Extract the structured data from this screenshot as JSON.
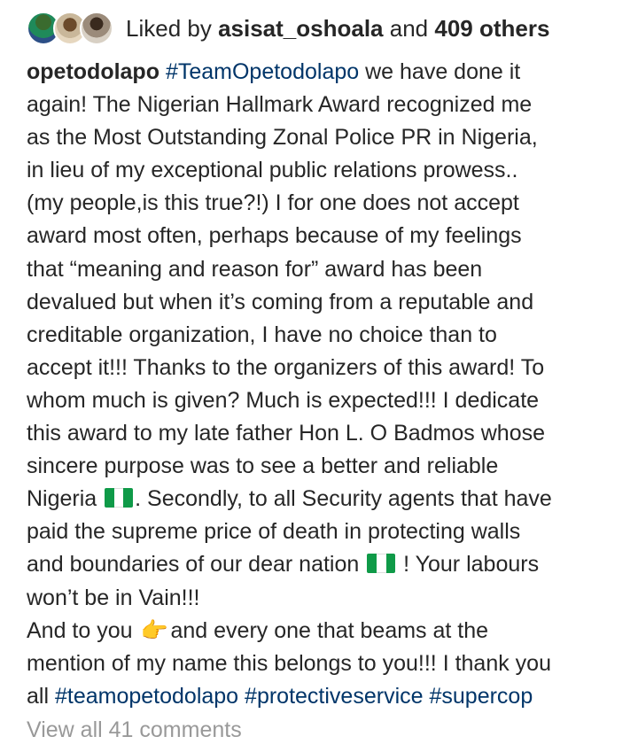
{
  "likes": {
    "prefix": "Liked by",
    "user": "asisat_oshoala",
    "conjunction": "and",
    "others": "409 others"
  },
  "post": {
    "username": "opetodolapo",
    "lines": [
      {
        "hashtag": "#TeamOpetodolapo",
        "text": " we have done it"
      },
      {
        "text": "again! The Nigerian Hallmark Award recognized me"
      },
      {
        "text": "as the Most Outstanding Zonal Police PR in Nigeria,"
      },
      {
        "text": "in lieu of my exceptional public relations prowess.."
      },
      {
        "text": "(my people,is this true?!) I for one does not accept"
      },
      {
        "text": "award most often, perhaps because of my feelings"
      },
      {
        "text": "that “meaning and reason for” award has been"
      },
      {
        "text": "devalued but when it’s coming from a reputable and"
      },
      {
        "text": "creditable organization, I have no choice than to"
      },
      {
        "text": "accept it!!! Thanks to the organizers of this award! To"
      },
      {
        "text": "whom much is given? Much is expected!!! I dedicate"
      },
      {
        "text": "this award to my late father Hon L. O Badmos whose"
      },
      {
        "text": "sincere purpose was to see a better and reliable"
      },
      {
        "text_before": "Nigeria ",
        "text_after": ". Secondly, to all Security agents that have"
      },
      {
        "text": "paid the supreme price of death in protecting walls"
      },
      {
        "text_before": "and boundaries of our dear nation ",
        "text_after": " ! Your labours"
      },
      {
        "text": "won’t be in Vain!!!"
      },
      {
        "text_before": "And to you ",
        "hand": "👉",
        "text_after": "and every one that beams at the"
      },
      {
        "text": "mention of my name this belongs to you!!! I thank you"
      },
      {
        "text": "all ",
        "tags": [
          "#teamopetodolapo",
          "#protectiveservice",
          "#supercop"
        ]
      }
    ]
  },
  "comments": {
    "view_all": "View all 41 comments"
  },
  "colors": {
    "text": "#262626",
    "hashtag": "#003569",
    "muted": "#999999"
  },
  "icons": [
    "nigeria-flag-icon",
    "pointing-right-hand-icon"
  ]
}
